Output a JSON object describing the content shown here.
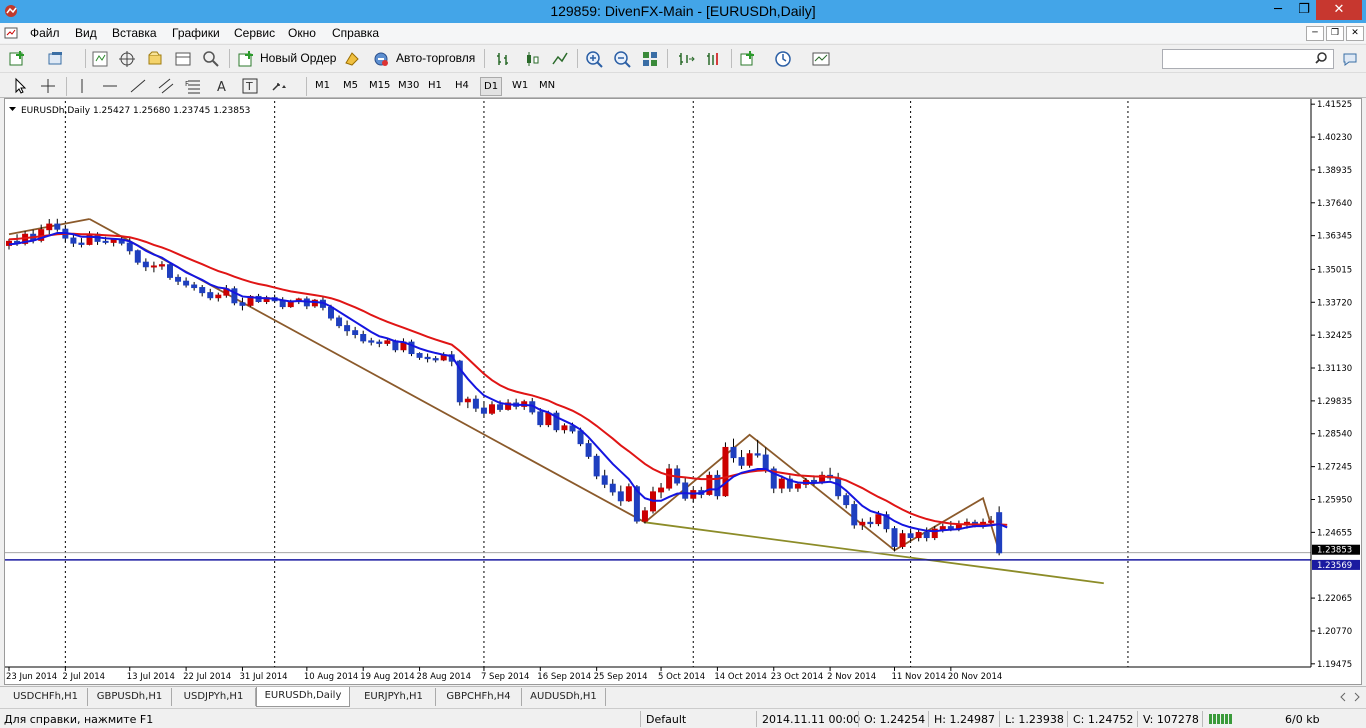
{
  "window": {
    "title": "129859: DivenFX-Main - [EURUSDh,Daily]",
    "minimize": "─",
    "maximize": "❐",
    "close": "✕"
  },
  "menu": {
    "items": [
      "Файл",
      "Вид",
      "Вставка",
      "Графики",
      "Сервис",
      "Окно",
      "Справка"
    ],
    "mdi_min": "─",
    "mdi_restore": "❐",
    "mdi_close": "✕"
  },
  "toolbar": {
    "new_order": "Новый Ордер",
    "autotrading": "Авто-торговля",
    "search_placeholder": ""
  },
  "timeframes": [
    "M1",
    "M5",
    "M15",
    "M30",
    "H1",
    "H4",
    "D1",
    "W1",
    "MN"
  ],
  "active_timeframe": "D1",
  "chart_data": {
    "type": "candlestick",
    "header": "EURUSDh,Daily  1.25427 1.25680 1.23745 1.23853",
    "price_scale": [
      "1.41525",
      "1.40230",
      "1.38935",
      "1.37640",
      "1.36345",
      "1.35015",
      "1.33720",
      "1.32425",
      "1.31130",
      "1.29835",
      "1.28540",
      "1.27245",
      "1.25950",
      "1.24655",
      "1.23853",
      "1.23569",
      "1.22065",
      "1.20770",
      "1.19475"
    ],
    "ylim": [
      1.1935,
      1.4165
    ],
    "current_price": "1.23853",
    "horizontal_line": "1.23569",
    "date_labels": [
      "23 Jun 2014",
      "2 Jul 2014",
      "13 Jul 2014",
      "22 Jul 2014",
      "31 Jul 2014",
      "10 Aug 2014",
      "19 Aug 2014",
      "28 Aug 2014",
      "7 Sep 2014",
      "16 Sep 2014",
      "25 Sep 2014",
      "5 Oct 2014",
      "14 Oct 2014",
      "23 Oct 2014",
      "2 Nov 2014",
      "11 Nov 2014",
      "20 Nov 2014"
    ],
    "period_separators": [
      "1 Jul 2014",
      "1 Aug 2014",
      "1 Sep 2014",
      "1 Oct 2014",
      "3 Nov 2014",
      "1 Dec 2014"
    ],
    "candles": [
      {
        "o": 1.3596,
        "h": 1.3622,
        "l": 1.358,
        "c": 1.3612
      },
      {
        "o": 1.3612,
        "h": 1.364,
        "l": 1.3594,
        "c": 1.3604
      },
      {
        "o": 1.3604,
        "h": 1.3652,
        "l": 1.3596,
        "c": 1.364
      },
      {
        "o": 1.364,
        "h": 1.3658,
        "l": 1.3604,
        "c": 1.3616
      },
      {
        "o": 1.3616,
        "h": 1.3678,
        "l": 1.3608,
        "c": 1.3658
      },
      {
        "o": 1.3658,
        "h": 1.37,
        "l": 1.364,
        "c": 1.368
      },
      {
        "o": 1.368,
        "h": 1.3701,
        "l": 1.365,
        "c": 1.366
      },
      {
        "o": 1.366,
        "h": 1.3676,
        "l": 1.361,
        "c": 1.3625
      },
      {
        "o": 1.3625,
        "h": 1.3638,
        "l": 1.359,
        "c": 1.3605
      },
      {
        "o": 1.3605,
        "h": 1.3625,
        "l": 1.3588,
        "c": 1.36
      },
      {
        "o": 1.36,
        "h": 1.3652,
        "l": 1.3596,
        "c": 1.364
      },
      {
        "o": 1.364,
        "h": 1.3648,
        "l": 1.3598,
        "c": 1.3612
      },
      {
        "o": 1.3612,
        "h": 1.363,
        "l": 1.36,
        "c": 1.3608
      },
      {
        "o": 1.3608,
        "h": 1.3625,
        "l": 1.3592,
        "c": 1.3618
      },
      {
        "o": 1.3618,
        "h": 1.3632,
        "l": 1.3596,
        "c": 1.3605
      },
      {
        "o": 1.3605,
        "h": 1.363,
        "l": 1.356,
        "c": 1.3575
      },
      {
        "o": 1.3575,
        "h": 1.358,
        "l": 1.352,
        "c": 1.353
      },
      {
        "o": 1.353,
        "h": 1.3545,
        "l": 1.3495,
        "c": 1.3512
      },
      {
        "o": 1.3512,
        "h": 1.3532,
        "l": 1.349,
        "c": 1.3515
      },
      {
        "o": 1.3515,
        "h": 1.3534,
        "l": 1.35,
        "c": 1.352
      },
      {
        "o": 1.352,
        "h": 1.3525,
        "l": 1.346,
        "c": 1.347
      },
      {
        "o": 1.347,
        "h": 1.3482,
        "l": 1.344,
        "c": 1.3455
      },
      {
        "o": 1.3455,
        "h": 1.347,
        "l": 1.343,
        "c": 1.344
      },
      {
        "o": 1.344,
        "h": 1.3452,
        "l": 1.3418,
        "c": 1.343
      },
      {
        "o": 1.343,
        "h": 1.344,
        "l": 1.3395,
        "c": 1.341
      },
      {
        "o": 1.341,
        "h": 1.3425,
        "l": 1.338,
        "c": 1.339
      },
      {
        "o": 1.339,
        "h": 1.341,
        "l": 1.3375,
        "c": 1.34
      },
      {
        "o": 1.34,
        "h": 1.344,
        "l": 1.339,
        "c": 1.3425
      },
      {
        "o": 1.3425,
        "h": 1.3435,
        "l": 1.336,
        "c": 1.337
      },
      {
        "o": 1.337,
        "h": 1.339,
        "l": 1.334,
        "c": 1.336
      },
      {
        "o": 1.336,
        "h": 1.34,
        "l": 1.3355,
        "c": 1.3395
      },
      {
        "o": 1.3395,
        "h": 1.3405,
        "l": 1.337,
        "c": 1.3375
      },
      {
        "o": 1.3375,
        "h": 1.3398,
        "l": 1.3365,
        "c": 1.339
      },
      {
        "o": 1.339,
        "h": 1.3402,
        "l": 1.337,
        "c": 1.3378
      },
      {
        "o": 1.3378,
        "h": 1.3392,
        "l": 1.3345,
        "c": 1.3355
      },
      {
        "o": 1.3355,
        "h": 1.3382,
        "l": 1.335,
        "c": 1.3375
      },
      {
        "o": 1.3375,
        "h": 1.339,
        "l": 1.3365,
        "c": 1.3385
      },
      {
        "o": 1.3385,
        "h": 1.3395,
        "l": 1.3345,
        "c": 1.3358
      },
      {
        "o": 1.3358,
        "h": 1.3385,
        "l": 1.335,
        "c": 1.338
      },
      {
        "o": 1.338,
        "h": 1.3395,
        "l": 1.334,
        "c": 1.3352
      },
      {
        "o": 1.3352,
        "h": 1.3362,
        "l": 1.33,
        "c": 1.331
      },
      {
        "o": 1.331,
        "h": 1.332,
        "l": 1.327,
        "c": 1.328
      },
      {
        "o": 1.328,
        "h": 1.33,
        "l": 1.324,
        "c": 1.326
      },
      {
        "o": 1.326,
        "h": 1.3275,
        "l": 1.323,
        "c": 1.3245
      },
      {
        "o": 1.3245,
        "h": 1.326,
        "l": 1.321,
        "c": 1.322
      },
      {
        "o": 1.322,
        "h": 1.3232,
        "l": 1.3202,
        "c": 1.3215
      },
      {
        "o": 1.3215,
        "h": 1.3225,
        "l": 1.3195,
        "c": 1.321
      },
      {
        "o": 1.321,
        "h": 1.3232,
        "l": 1.32,
        "c": 1.322
      },
      {
        "o": 1.322,
        "h": 1.3225,
        "l": 1.3175,
        "c": 1.3185
      },
      {
        "o": 1.3185,
        "h": 1.323,
        "l": 1.3175,
        "c": 1.3215
      },
      {
        "o": 1.3215,
        "h": 1.3225,
        "l": 1.316,
        "c": 1.317
      },
      {
        "o": 1.317,
        "h": 1.3175,
        "l": 1.3145,
        "c": 1.3155
      },
      {
        "o": 1.3155,
        "h": 1.317,
        "l": 1.3135,
        "c": 1.315
      },
      {
        "o": 1.315,
        "h": 1.316,
        "l": 1.3135,
        "c": 1.3145
      },
      {
        "o": 1.3145,
        "h": 1.3175,
        "l": 1.314,
        "c": 1.3165
      },
      {
        "o": 1.3165,
        "h": 1.318,
        "l": 1.312,
        "c": 1.314
      },
      {
        "o": 1.314,
        "h": 1.3145,
        "l": 1.2965,
        "c": 1.298
      },
      {
        "o": 1.298,
        "h": 1.3,
        "l": 1.2955,
        "c": 1.299
      },
      {
        "o": 1.299,
        "h": 1.3005,
        "l": 1.294,
        "c": 1.2955
      },
      {
        "o": 1.2955,
        "h": 1.298,
        "l": 1.2918,
        "c": 1.2935
      },
      {
        "o": 1.2935,
        "h": 1.2982,
        "l": 1.2928,
        "c": 1.2968
      },
      {
        "o": 1.2968,
        "h": 1.2985,
        "l": 1.294,
        "c": 1.295
      },
      {
        "o": 1.295,
        "h": 1.299,
        "l": 1.2945,
        "c": 1.2975
      },
      {
        "o": 1.2975,
        "h": 1.2992,
        "l": 1.295,
        "c": 1.2962
      },
      {
        "o": 1.2962,
        "h": 1.2988,
        "l": 1.2948,
        "c": 1.298
      },
      {
        "o": 1.298,
        "h": 1.2995,
        "l": 1.293,
        "c": 1.294
      },
      {
        "o": 1.294,
        "h": 1.2955,
        "l": 1.288,
        "c": 1.289
      },
      {
        "o": 1.289,
        "h": 1.2945,
        "l": 1.288,
        "c": 1.2935
      },
      {
        "o": 1.2935,
        "h": 1.2945,
        "l": 1.286,
        "c": 1.287
      },
      {
        "o": 1.287,
        "h": 1.2895,
        "l": 1.2855,
        "c": 1.2885
      },
      {
        "o": 1.2885,
        "h": 1.2898,
        "l": 1.2855,
        "c": 1.2865
      },
      {
        "o": 1.2865,
        "h": 1.2878,
        "l": 1.2805,
        "c": 1.2815
      },
      {
        "o": 1.2815,
        "h": 1.283,
        "l": 1.2755,
        "c": 1.2765
      },
      {
        "o": 1.2765,
        "h": 1.2775,
        "l": 1.2675,
        "c": 1.2688
      },
      {
        "o": 1.2688,
        "h": 1.2712,
        "l": 1.264,
        "c": 1.2655
      },
      {
        "o": 1.2655,
        "h": 1.2675,
        "l": 1.261,
        "c": 1.2625
      },
      {
        "o": 1.2625,
        "h": 1.265,
        "l": 1.257,
        "c": 1.259
      },
      {
        "o": 1.259,
        "h": 1.2658,
        "l": 1.2585,
        "c": 1.2645
      },
      {
        "o": 1.2645,
        "h": 1.2652,
        "l": 1.25,
        "c": 1.251
      },
      {
        "o": 1.251,
        "h": 1.2565,
        "l": 1.25,
        "c": 1.255
      },
      {
        "o": 1.255,
        "h": 1.2645,
        "l": 1.254,
        "c": 1.2625
      },
      {
        "o": 1.2625,
        "h": 1.266,
        "l": 1.26,
        "c": 1.264
      },
      {
        "o": 1.264,
        "h": 1.2735,
        "l": 1.263,
        "c": 1.2715
      },
      {
        "o": 1.2715,
        "h": 1.273,
        "l": 1.265,
        "c": 1.266
      },
      {
        "o": 1.266,
        "h": 1.268,
        "l": 1.259,
        "c": 1.26
      },
      {
        "o": 1.26,
        "h": 1.264,
        "l": 1.2585,
        "c": 1.263
      },
      {
        "o": 1.263,
        "h": 1.2645,
        "l": 1.26,
        "c": 1.2615
      },
      {
        "o": 1.2615,
        "h": 1.2705,
        "l": 1.261,
        "c": 1.269
      },
      {
        "o": 1.269,
        "h": 1.271,
        "l": 1.2595,
        "c": 1.261
      },
      {
        "o": 1.261,
        "h": 1.282,
        "l": 1.2605,
        "c": 1.28
      },
      {
        "o": 1.28,
        "h": 1.2835,
        "l": 1.274,
        "c": 1.276
      },
      {
        "o": 1.276,
        "h": 1.279,
        "l": 1.2715,
        "c": 1.273
      },
      {
        "o": 1.273,
        "h": 1.279,
        "l": 1.272,
        "c": 1.2775
      },
      {
        "o": 1.2775,
        "h": 1.283,
        "l": 1.276,
        "c": 1.277
      },
      {
        "o": 1.277,
        "h": 1.28,
        "l": 1.27,
        "c": 1.2715
      },
      {
        "o": 1.2715,
        "h": 1.2725,
        "l": 1.262,
        "c": 1.264
      },
      {
        "o": 1.264,
        "h": 1.269,
        "l": 1.262,
        "c": 1.2675
      },
      {
        "o": 1.2675,
        "h": 1.269,
        "l": 1.2625,
        "c": 1.264
      },
      {
        "o": 1.264,
        "h": 1.2665,
        "l": 1.2625,
        "c": 1.2655
      },
      {
        "o": 1.2655,
        "h": 1.268,
        "l": 1.264,
        "c": 1.267
      },
      {
        "o": 1.267,
        "h": 1.269,
        "l": 1.265,
        "c": 1.2665
      },
      {
        "o": 1.2665,
        "h": 1.2705,
        "l": 1.2655,
        "c": 1.269
      },
      {
        "o": 1.269,
        "h": 1.272,
        "l": 1.267,
        "c": 1.268
      },
      {
        "o": 1.268,
        "h": 1.27,
        "l": 1.2595,
        "c": 1.261
      },
      {
        "o": 1.261,
        "h": 1.262,
        "l": 1.256,
        "c": 1.2575
      },
      {
        "o": 1.2575,
        "h": 1.259,
        "l": 1.248,
        "c": 1.2495
      },
      {
        "o": 1.2495,
        "h": 1.252,
        "l": 1.2475,
        "c": 1.2505
      },
      {
        "o": 1.2505,
        "h": 1.2525,
        "l": 1.2485,
        "c": 1.25
      },
      {
        "o": 1.25,
        "h": 1.255,
        "l": 1.249,
        "c": 1.2535
      },
      {
        "o": 1.2535,
        "h": 1.2548,
        "l": 1.2465,
        "c": 1.248
      },
      {
        "o": 1.248,
        "h": 1.249,
        "l": 1.239,
        "c": 1.241
      },
      {
        "o": 1.241,
        "h": 1.2475,
        "l": 1.24,
        "c": 1.246
      },
      {
        "o": 1.246,
        "h": 1.248,
        "l": 1.243,
        "c": 1.2445
      },
      {
        "o": 1.2445,
        "h": 1.2475,
        "l": 1.243,
        "c": 1.2465
      },
      {
        "o": 1.2465,
        "h": 1.2485,
        "l": 1.243,
        "c": 1.2445
      },
      {
        "o": 1.2445,
        "h": 1.249,
        "l": 1.2435,
        "c": 1.2478
      },
      {
        "o": 1.2478,
        "h": 1.25,
        "l": 1.2465,
        "c": 1.2488
      },
      {
        "o": 1.2488,
        "h": 1.251,
        "l": 1.247,
        "c": 1.248
      },
      {
        "o": 1.248,
        "h": 1.2512,
        "l": 1.247,
        "c": 1.2495
      },
      {
        "o": 1.2495,
        "h": 1.252,
        "l": 1.248,
        "c": 1.2505
      },
      {
        "o": 1.2505,
        "h": 1.2515,
        "l": 1.2485,
        "c": 1.249
      },
      {
        "o": 1.249,
        "h": 1.252,
        "l": 1.248,
        "c": 1.2505
      },
      {
        "o": 1.2505,
        "h": 1.253,
        "l": 1.249,
        "c": 1.251
      },
      {
        "o": 1.2543,
        "h": 1.2568,
        "l": 1.2375,
        "c": 1.2385
      }
    ],
    "ma_fast": [
      1.36,
      1.3603,
      1.361,
      1.3615,
      1.3625,
      1.3635,
      1.3645,
      1.3645,
      1.364,
      1.363,
      1.363,
      1.3628,
      1.3624,
      1.3622,
      1.362,
      1.3612,
      1.3595,
      1.3575,
      1.356,
      1.3548,
      1.3528,
      1.351,
      1.349,
      1.3475,
      1.346,
      1.3442,
      1.343,
      1.3426,
      1.341,
      1.3395,
      1.3392,
      1.3389,
      1.3388,
      1.3386,
      1.338,
      1.3375,
      1.3377,
      1.3375,
      1.3373,
      1.337,
      1.3355,
      1.3335,
      1.3315,
      1.3295,
      1.3275,
      1.3255,
      1.3238,
      1.323,
      1.3218,
      1.3215,
      1.3203,
      1.319,
      1.318,
      1.3172,
      1.3165,
      1.316,
      1.311,
      1.307,
      1.3035,
      1.3005,
      1.299,
      1.2975,
      1.297,
      1.2968,
      1.2968,
      1.2965,
      1.2948,
      1.2938,
      1.292,
      1.2905,
      1.289,
      1.287,
      1.284,
      1.2805,
      1.277,
      1.2735,
      1.2705,
      1.2675,
      1.263,
      1.26,
      1.259,
      1.259,
      1.2605,
      1.2618,
      1.262,
      1.2618,
      1.262,
      1.2635,
      1.2635,
      1.266,
      1.2685,
      1.27,
      1.2708,
      1.2715,
      1.2715,
      1.2698,
      1.2685,
      1.267,
      1.2662,
      1.266,
      1.266,
      1.2662,
      1.2665,
      1.2655,
      1.263,
      1.26,
      1.257,
      1.255,
      1.254,
      1.253,
      1.251,
      1.2495,
      1.2485,
      1.2478,
      1.2472,
      1.247,
      1.2474,
      1.2476,
      1.2478,
      1.2485,
      1.249,
      1.249,
      1.2493,
      1.2498,
      1.2485
    ],
    "ma_slow": [
      1.362,
      1.3622,
      1.3625,
      1.3628,
      1.3632,
      1.3636,
      1.364,
      1.3642,
      1.3642,
      1.364,
      1.364,
      1.3638,
      1.3636,
      1.3634,
      1.3632,
      1.3628,
      1.362,
      1.361,
      1.3598,
      1.3588,
      1.3576,
      1.3562,
      1.3548,
      1.3535,
      1.3522,
      1.3508,
      1.3495,
      1.3485,
      1.3473,
      1.3462,
      1.3452,
      1.3444,
      1.3438,
      1.343,
      1.3422,
      1.3415,
      1.341,
      1.3405,
      1.34,
      1.3395,
      1.3388,
      1.3378,
      1.3365,
      1.3352,
      1.3338,
      1.3322,
      1.3308,
      1.3295,
      1.3283,
      1.3272,
      1.326,
      1.3248,
      1.3236,
      1.3225,
      1.3215,
      1.3205,
      1.318,
      1.315,
      1.312,
      1.309,
      1.3065,
      1.3045,
      1.303,
      1.302,
      1.3012,
      1.3005,
      1.2995,
      1.2985,
      1.297,
      1.2958,
      1.2945,
      1.2928,
      1.2908,
      1.2885,
      1.286,
      1.2835,
      1.2808,
      1.2785,
      1.276,
      1.2735,
      1.2715,
      1.27,
      1.269,
      1.2685,
      1.2682,
      1.2678,
      1.2675,
      1.2675,
      1.2676,
      1.2682,
      1.269,
      1.2698,
      1.2704,
      1.2708,
      1.271,
      1.2705,
      1.27,
      1.2695,
      1.269,
      1.2688,
      1.2686,
      1.2685,
      1.2684,
      1.268,
      1.267,
      1.2655,
      1.264,
      1.2622,
      1.2605,
      1.259,
      1.2572,
      1.2555,
      1.254,
      1.2528,
      1.2518,
      1.251,
      1.2505,
      1.25,
      1.2498,
      1.2497,
      1.2497,
      1.2496,
      1.2496,
      1.2497,
      1.2495
    ],
    "trendlines": [
      {
        "name": "down-channel-upper",
        "from": {
          "i": 0,
          "p": 1.364
        },
        "to": {
          "i": 10,
          "p": 1.37
        }
      },
      {
        "name": "down-trend",
        "from": {
          "i": 10,
          "p": 1.37
        },
        "to": {
          "i": 79,
          "p": 1.2505
        }
      },
      {
        "name": "support",
        "from": {
          "i": 79,
          "p": 1.2505
        },
        "to": {
          "i": 136,
          "p": 1.2265
        }
      },
      {
        "name": "zigzag",
        "points": [
          {
            "i": 79,
            "p": 1.2505
          },
          {
            "i": 92,
            "p": 1.285
          },
          {
            "i": 110,
            "p": 1.2395
          },
          {
            "i": 121,
            "p": 1.26
          },
          {
            "i": 123,
            "p": 1.239
          }
        ]
      }
    ]
  },
  "tabs": [
    "USDCHFh,H1",
    "GBPUSDh,H1",
    "USDJPYh,H1",
    "EURUSDh,Daily",
    "EURJPYh,H1",
    "GBPCHFh,H4",
    "AUDUSDh,H1"
  ],
  "active_tab": "EURUSDh,Daily",
  "status": {
    "help": "Для справки, нажмите F1",
    "profile": "Default",
    "datetime": "2014.11.11 00:00",
    "open": "O: 1.24254",
    "high": "H: 1.24987",
    "low": "L: 1.23938",
    "close": "C: 1.24752",
    "volume": "V: 107278",
    "traffic": "6/0 kb"
  },
  "colors": {
    "bull": "#cc0000",
    "bear": "#1f3fbf",
    "ma_fast": "#1515e0",
    "ma_slow": "#e01515",
    "trend": "#8b5a2b",
    "support": "#8c8c28",
    "hline": "#1a1aa0",
    "price_tag": "#1a1aa0"
  }
}
